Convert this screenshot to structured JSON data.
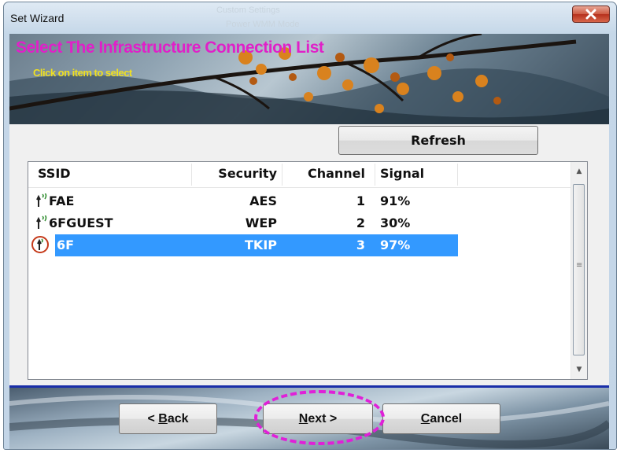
{
  "window": {
    "title": "Set Wizard",
    "background_ghost_text": [
      "Custom Settings",
      "Power WMM Mode"
    ]
  },
  "banner": {
    "title": "Select The Infrastructure Connection List",
    "subtitle": "Click on item to select",
    "title_color": "#e020c8",
    "subtitle_color": "#f0e020"
  },
  "toolbar": {
    "refresh_label": "Refresh"
  },
  "list": {
    "columns": [
      "SSID",
      "Security",
      "Channel",
      "Signal"
    ],
    "rows": [
      {
        "ssid": "FAE",
        "security": "AES",
        "channel": "1",
        "signal": "91%",
        "selected": false,
        "icon": "antenna-icon"
      },
      {
        "ssid": "6FGUEST",
        "security": "WEP",
        "channel": "2",
        "signal": "30%",
        "selected": false,
        "icon": "antenna-icon"
      },
      {
        "ssid": "6F",
        "security": "TKIP",
        "channel": "3",
        "signal": "97%",
        "selected": true,
        "icon": "antenna-icon"
      }
    ],
    "selection_color": "#3399ff"
  },
  "footer": {
    "back_label": "< Back",
    "back_mnemonic": "B",
    "next_label": "Next >",
    "next_mnemonic": "N",
    "cancel_label": "Cancel",
    "cancel_mnemonic": "C",
    "highlight_color": "#e020d8"
  }
}
